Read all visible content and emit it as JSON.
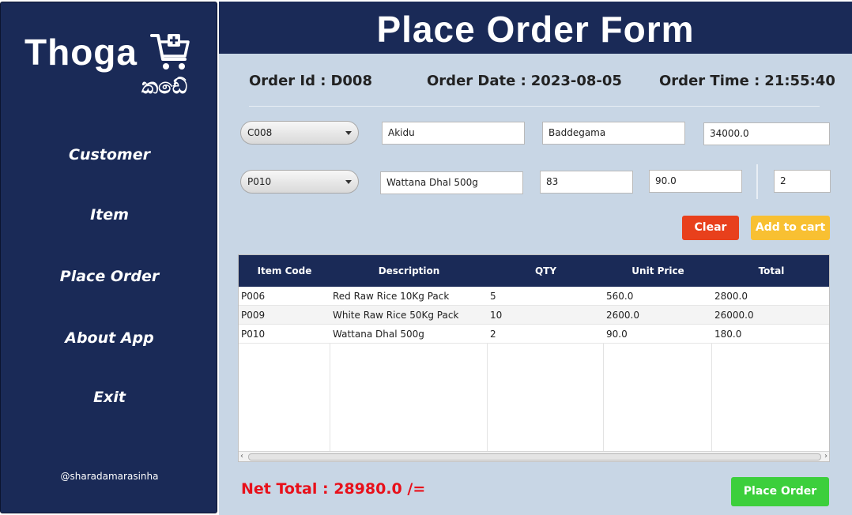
{
  "sidebar": {
    "logo_title": "Thoga",
    "logo_subtitle": "කඩේ",
    "logo_icon": "cart-plus-icon",
    "nav": [
      {
        "label": "Customer"
      },
      {
        "label": "Item"
      },
      {
        "label": "Place Order"
      },
      {
        "label": "About App"
      },
      {
        "label": "Exit"
      }
    ],
    "credit": "@sharadamarasinha"
  },
  "header": {
    "title": "Place Order Form"
  },
  "order_info": {
    "id_label": "Order Id :",
    "id_value": "D008",
    "date_label": "Order Date :",
    "date_value": "2023-08-05",
    "time_label": "Order Time :",
    "time_value": "21:55:40"
  },
  "customer": {
    "id_selected": "C008",
    "name": "Akidu",
    "address": "Baddegama",
    "salary": "34000.0"
  },
  "item": {
    "code_selected": "P010",
    "description": "Wattana Dhal 500g",
    "qty_on_hand": "83",
    "unit_price": "90.0",
    "order_qty": "2"
  },
  "buttons": {
    "clear": "Clear",
    "add_to_cart": "Add to cart",
    "place_order": "Place Order"
  },
  "cart_table": {
    "columns": [
      "Item Code",
      "Description",
      "QTY",
      "Unit Price",
      "Total"
    ],
    "rows": [
      [
        "P006",
        "Red Raw Rice 10Kg Pack",
        "5",
        "560.0",
        "2800.0"
      ],
      [
        "P009",
        "White Raw Rice 50Kg Pack",
        "10",
        "2600.0",
        "26000.0"
      ],
      [
        "P010",
        "Wattana Dhal 500g",
        "2",
        "90.0",
        "180.0"
      ]
    ]
  },
  "net_total": {
    "label": "Net Total :",
    "value": "28980.0 /="
  },
  "colors": {
    "navy": "#1a2a57",
    "panel": "#c8d6e5",
    "clear_button": "#e8401c",
    "add_button": "#f8c032",
    "place_button": "#3ccf3c",
    "net_total": "#e8101a"
  }
}
